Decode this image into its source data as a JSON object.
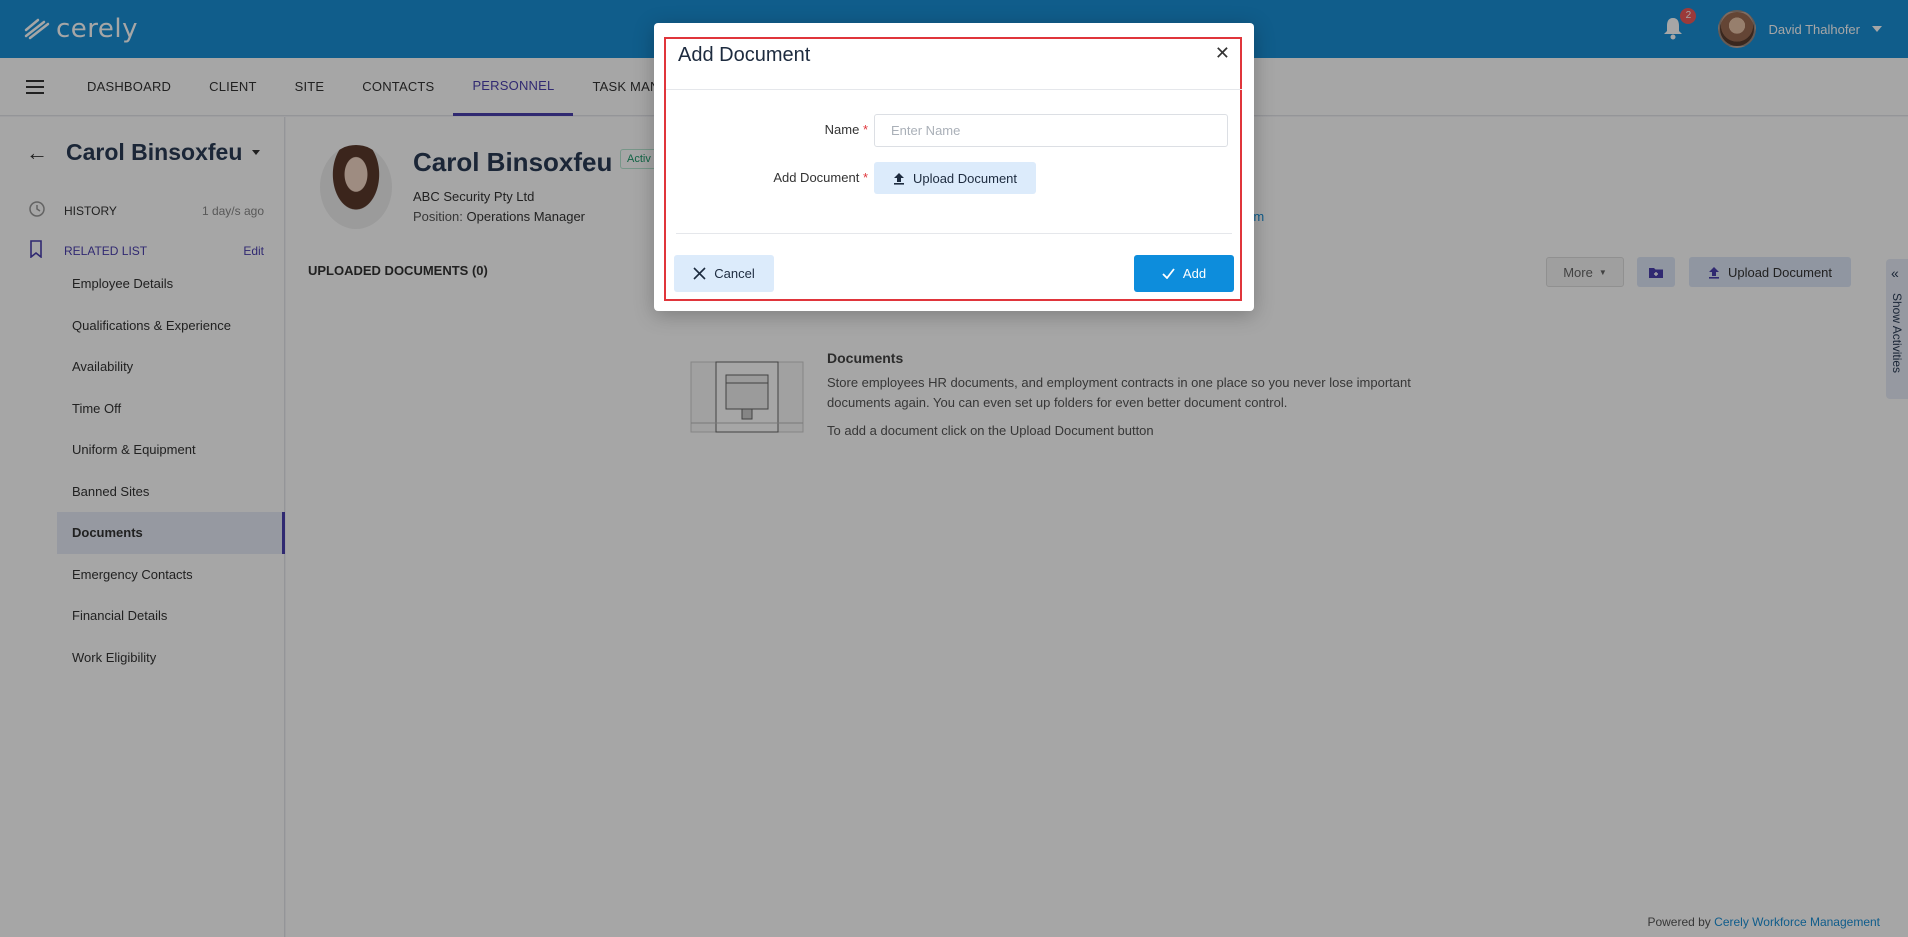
{
  "app": {
    "logo_text": "cerely",
    "notification_count": "2",
    "user_name": "David Thalhofer"
  },
  "nav": {
    "tabs": [
      "DASHBOARD",
      "CLIENT",
      "SITE",
      "CONTACTS",
      "PERSONNEL",
      "TASK MANAGER"
    ]
  },
  "sidebar": {
    "person_name": "Carol Binsoxfeu",
    "history_label": "HISTORY",
    "history_meta": "1 day/s ago",
    "related_label": "RELATED LIST",
    "related_edit": "Edit",
    "items": [
      "Employee Details",
      "Qualifications & Experience",
      "Availability",
      "Time Off",
      "Uniform & Equipment",
      "Banned Sites",
      "Documents",
      "Emergency Contacts",
      "Financial Details",
      "Work Eligibility"
    ]
  },
  "profile": {
    "name": "Carol Binsoxfeu",
    "status": "Activ",
    "company": "ABC Security Pty Ltd",
    "position_label": "Position:",
    "position_value": "Operations Manager",
    "email_fragment": ".com"
  },
  "documents": {
    "header": "UPLOADED DOCUMENTS (0)",
    "more_label": "More",
    "upload_label": "Upload Document",
    "empty_title": "Documents",
    "empty_desc": "Store employees HR documents, and employment contracts in one place so you never lose important documents again. You can even set up folders for even better document control.",
    "empty_hint": "To add a document click on the Upload Document button"
  },
  "activities": {
    "label": "Show Activities"
  },
  "footer": {
    "prefix": "Powered by",
    "link": "Cerely Workforce Management"
  },
  "modal": {
    "title": "Add Document",
    "name_label": "Name",
    "name_placeholder": "Enter Name",
    "name_value": "",
    "doc_label": "Add Document",
    "required_mark": "*",
    "upload_label": "Upload Document",
    "cancel_label": "Cancel",
    "add_label": "Add"
  },
  "colors": {
    "brand": "#1a8fd6",
    "accent": "#4b3fae",
    "primary_button": "#0d8ddc",
    "highlight_frame": "#e0353b"
  }
}
